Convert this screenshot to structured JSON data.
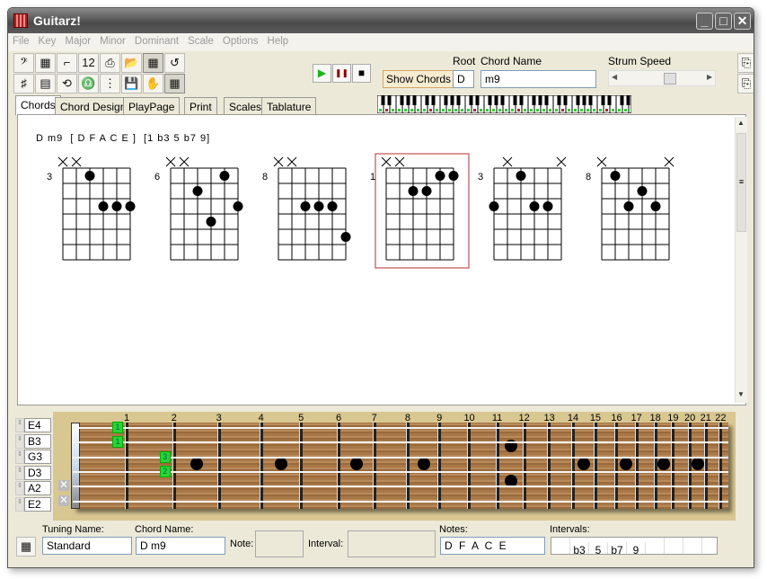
{
  "app": {
    "title": "Guitarz!"
  },
  "menu": [
    "File",
    "Key",
    "Major",
    "Minor",
    "Dominant",
    "Scale",
    "Options",
    "Help"
  ],
  "toolbar": {
    "row1": [
      {
        "icon": "bass-clef-icon",
        "g": "𝄢"
      },
      {
        "icon": "keyboard-icon",
        "g": "▦"
      },
      {
        "icon": "steps-icon",
        "g": "⌐"
      },
      {
        "icon": "numbers-icon",
        "g": "12"
      },
      {
        "icon": "print-icon",
        "g": "⎙"
      },
      {
        "icon": "open-folder-icon",
        "g": "📂"
      },
      {
        "icon": "grid-icon",
        "g": "▦"
      },
      {
        "icon": "undo-icon",
        "g": "↺"
      }
    ],
    "row2": [
      {
        "icon": "staff-icon",
        "g": "♯"
      },
      {
        "icon": "piano-icon",
        "g": "▤"
      },
      {
        "icon": "loop-icon",
        "g": "⟲"
      },
      {
        "icon": "metronome-icon",
        "g": "♎"
      },
      {
        "icon": "dots-icon",
        "g": "⋮"
      },
      {
        "icon": "save-icon",
        "g": "💾"
      },
      {
        "icon": "hand-icon",
        "g": "✋"
      },
      {
        "icon": "fretboard-icon",
        "g": "▦"
      }
    ],
    "play": "▶",
    "pause": "❚❚",
    "stop": "■",
    "show_chords": "Show Chords",
    "root_label": "Root",
    "root_value": "D",
    "chord_name_label": "Chord Name",
    "chord_name_value": "m9",
    "strum_label": "Strum Speed",
    "strum_value": 0.55
  },
  "tabs": [
    "Chords",
    "Chord Design",
    "PlayPage",
    "Print",
    "Scales",
    "Tablature"
  ],
  "active_tab": "Chords",
  "chords": {
    "heading": "D m9  [ D F A C E ]  [1 b3 5 b7 9]",
    "selected": 3,
    "diagrams": [
      {
        "fret": "3",
        "strings": [
          "x",
          "x",
          1,
          3,
          3,
          3
        ]
      },
      {
        "fret": "6",
        "strings": [
          "x",
          "x",
          2,
          4,
          1,
          3
        ]
      },
      {
        "fret": "8",
        "strings": [
          "x",
          "x",
          3,
          3,
          3,
          5
        ]
      },
      {
        "fret": "1",
        "strings": [
          "x",
          "x",
          2,
          2,
          1,
          1
        ]
      },
      {
        "fret": "3",
        "strings": [
          3,
          "x",
          1,
          3,
          3,
          "x"
        ]
      },
      {
        "fret": "8",
        "strings": [
          "x",
          1,
          3,
          2,
          3,
          "x"
        ]
      }
    ]
  },
  "fretboard": {
    "strings": [
      "E4",
      "B3",
      "G3",
      "D3",
      "A2",
      "E2"
    ],
    "fret_numbers": [
      "1",
      "2",
      "3",
      "4",
      "5",
      "6",
      "7",
      "8",
      "9",
      "10",
      "11",
      "12",
      "13",
      "14",
      "15",
      "16",
      "17",
      "18",
      "19",
      "20",
      "21",
      "22"
    ],
    "inlays": [
      3,
      5,
      7,
      9,
      15,
      17,
      19,
      21
    ],
    "double_inlay": 12,
    "fingering": [
      {
        "string": 0,
        "fret": 1,
        "finger": "1"
      },
      {
        "string": 1,
        "fret": 1,
        "finger": "1"
      },
      {
        "string": 2,
        "fret": 2,
        "finger": "3"
      },
      {
        "string": 3,
        "fret": 2,
        "finger": "2"
      }
    ],
    "muted": [
      4,
      5
    ],
    "mute_glyph": "✕"
  },
  "bottom": {
    "tuning_label": "Tuning Name:",
    "tuning_value": "Standard",
    "chord_label": "Chord Name:",
    "chord_value": "D m9",
    "note_label": "Note:",
    "note_value": "",
    "interval_label": "Interval:",
    "interval_value": "",
    "notes_label": "Notes:",
    "notes_value": "D F A C E",
    "intervals_label": "Intervals:",
    "intervals": [
      "",
      "b3",
      "5",
      "b7",
      "9",
      "",
      "",
      ""
    ]
  },
  "colors": {
    "finger": "#27d43a",
    "selected_border": "#b03030",
    "play": "#1db31d",
    "pause": "#8b0000"
  }
}
